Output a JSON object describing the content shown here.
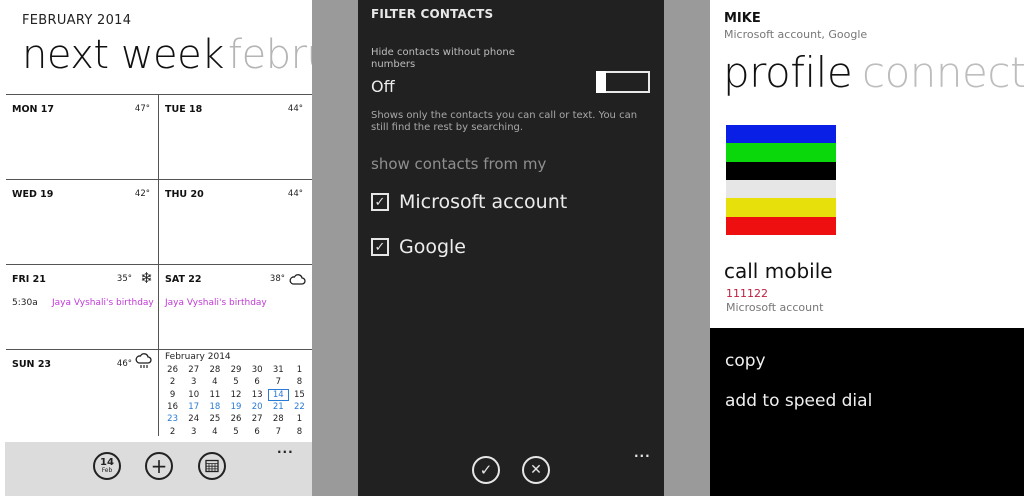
{
  "calendar": {
    "month_header": "FEBRUARY 2014",
    "pivot_current": "next week",
    "pivot_next": "febru",
    "days": [
      {
        "day": "MON 17",
        "temp": "47°",
        "icon": ""
      },
      {
        "day": "TUE 18",
        "temp": "44°",
        "icon": ""
      },
      {
        "day": "WED 19",
        "temp": "42°",
        "icon": ""
      },
      {
        "day": "THU 20",
        "temp": "44°",
        "icon": ""
      },
      {
        "day": "FRI 21",
        "temp": "35°",
        "icon": "snow-icon",
        "event_time": "5:30a",
        "event": "Jaya Vyshali's birthday"
      },
      {
        "day": "SAT 22",
        "temp": "38°",
        "icon": "cloud-icon",
        "event": "Jaya Vyshali's birthday"
      },
      {
        "day": "SUN 23",
        "temp": "46°",
        "icon": "rain-cloud-icon"
      }
    ],
    "mini_calendar": {
      "title": "February 2014",
      "weeks": [
        [
          "26",
          "27",
          "28",
          "29",
          "30",
          "31",
          "1"
        ],
        [
          "2",
          "3",
          "4",
          "5",
          "6",
          "7",
          "8"
        ],
        [
          "9",
          "10",
          "11",
          "12",
          "13",
          "14",
          "15"
        ],
        [
          "16",
          "17",
          "18",
          "19",
          "20",
          "21",
          "22"
        ],
        [
          "23",
          "24",
          "25",
          "26",
          "27",
          "28",
          "1"
        ],
        [
          "2",
          "3",
          "4",
          "5",
          "6",
          "7",
          "8"
        ]
      ],
      "today": "14"
    },
    "appbar": {
      "today_day": "14",
      "today_month": "Feb",
      "more": "..."
    }
  },
  "filter": {
    "title": "FILTER CONTACTS",
    "option_label": "Hide contacts without phone numbers",
    "option_state": "Off",
    "note": "Shows only the contacts you can call or text. You can still find the rest by searching.",
    "section": "show contacts from my",
    "accounts": [
      {
        "label": "Microsoft account",
        "checked": true
      },
      {
        "label": "Google",
        "checked": true
      }
    ],
    "more": "..."
  },
  "profile": {
    "name": "MIKE",
    "accounts": "Microsoft account, Google",
    "pivot_current": "profile",
    "pivot_next": "connect",
    "photo_stripes": [
      "#0a1fe6",
      "#0ad80a",
      "#000000",
      "#e6e6e6",
      "#e8e00a",
      "#ee1010"
    ],
    "call_label": "call mobile",
    "phone": "111122",
    "phone_source": "Microsoft account",
    "context_menu": [
      "copy",
      "add to speed dial"
    ]
  }
}
